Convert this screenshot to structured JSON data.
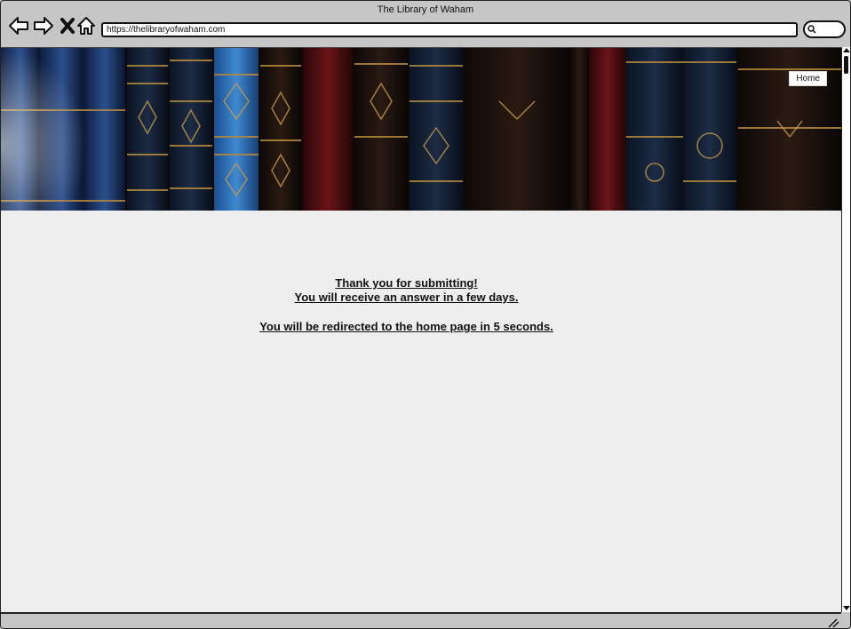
{
  "browser": {
    "window_title": "The Library of Waham",
    "url": "https://thelibraryofwaham.com"
  },
  "nav": {
    "home_label": "Home"
  },
  "message": {
    "line1": "Thank you for submitting!",
    "line2": "You will receive an answer in a few days.",
    "line3": "You will be redirected to the home page in 5 seconds."
  },
  "icons": {
    "back": "back-arrow-icon",
    "forward": "forward-arrow-icon",
    "stop": "close-icon",
    "home": "home-icon",
    "search": "search-icon"
  }
}
